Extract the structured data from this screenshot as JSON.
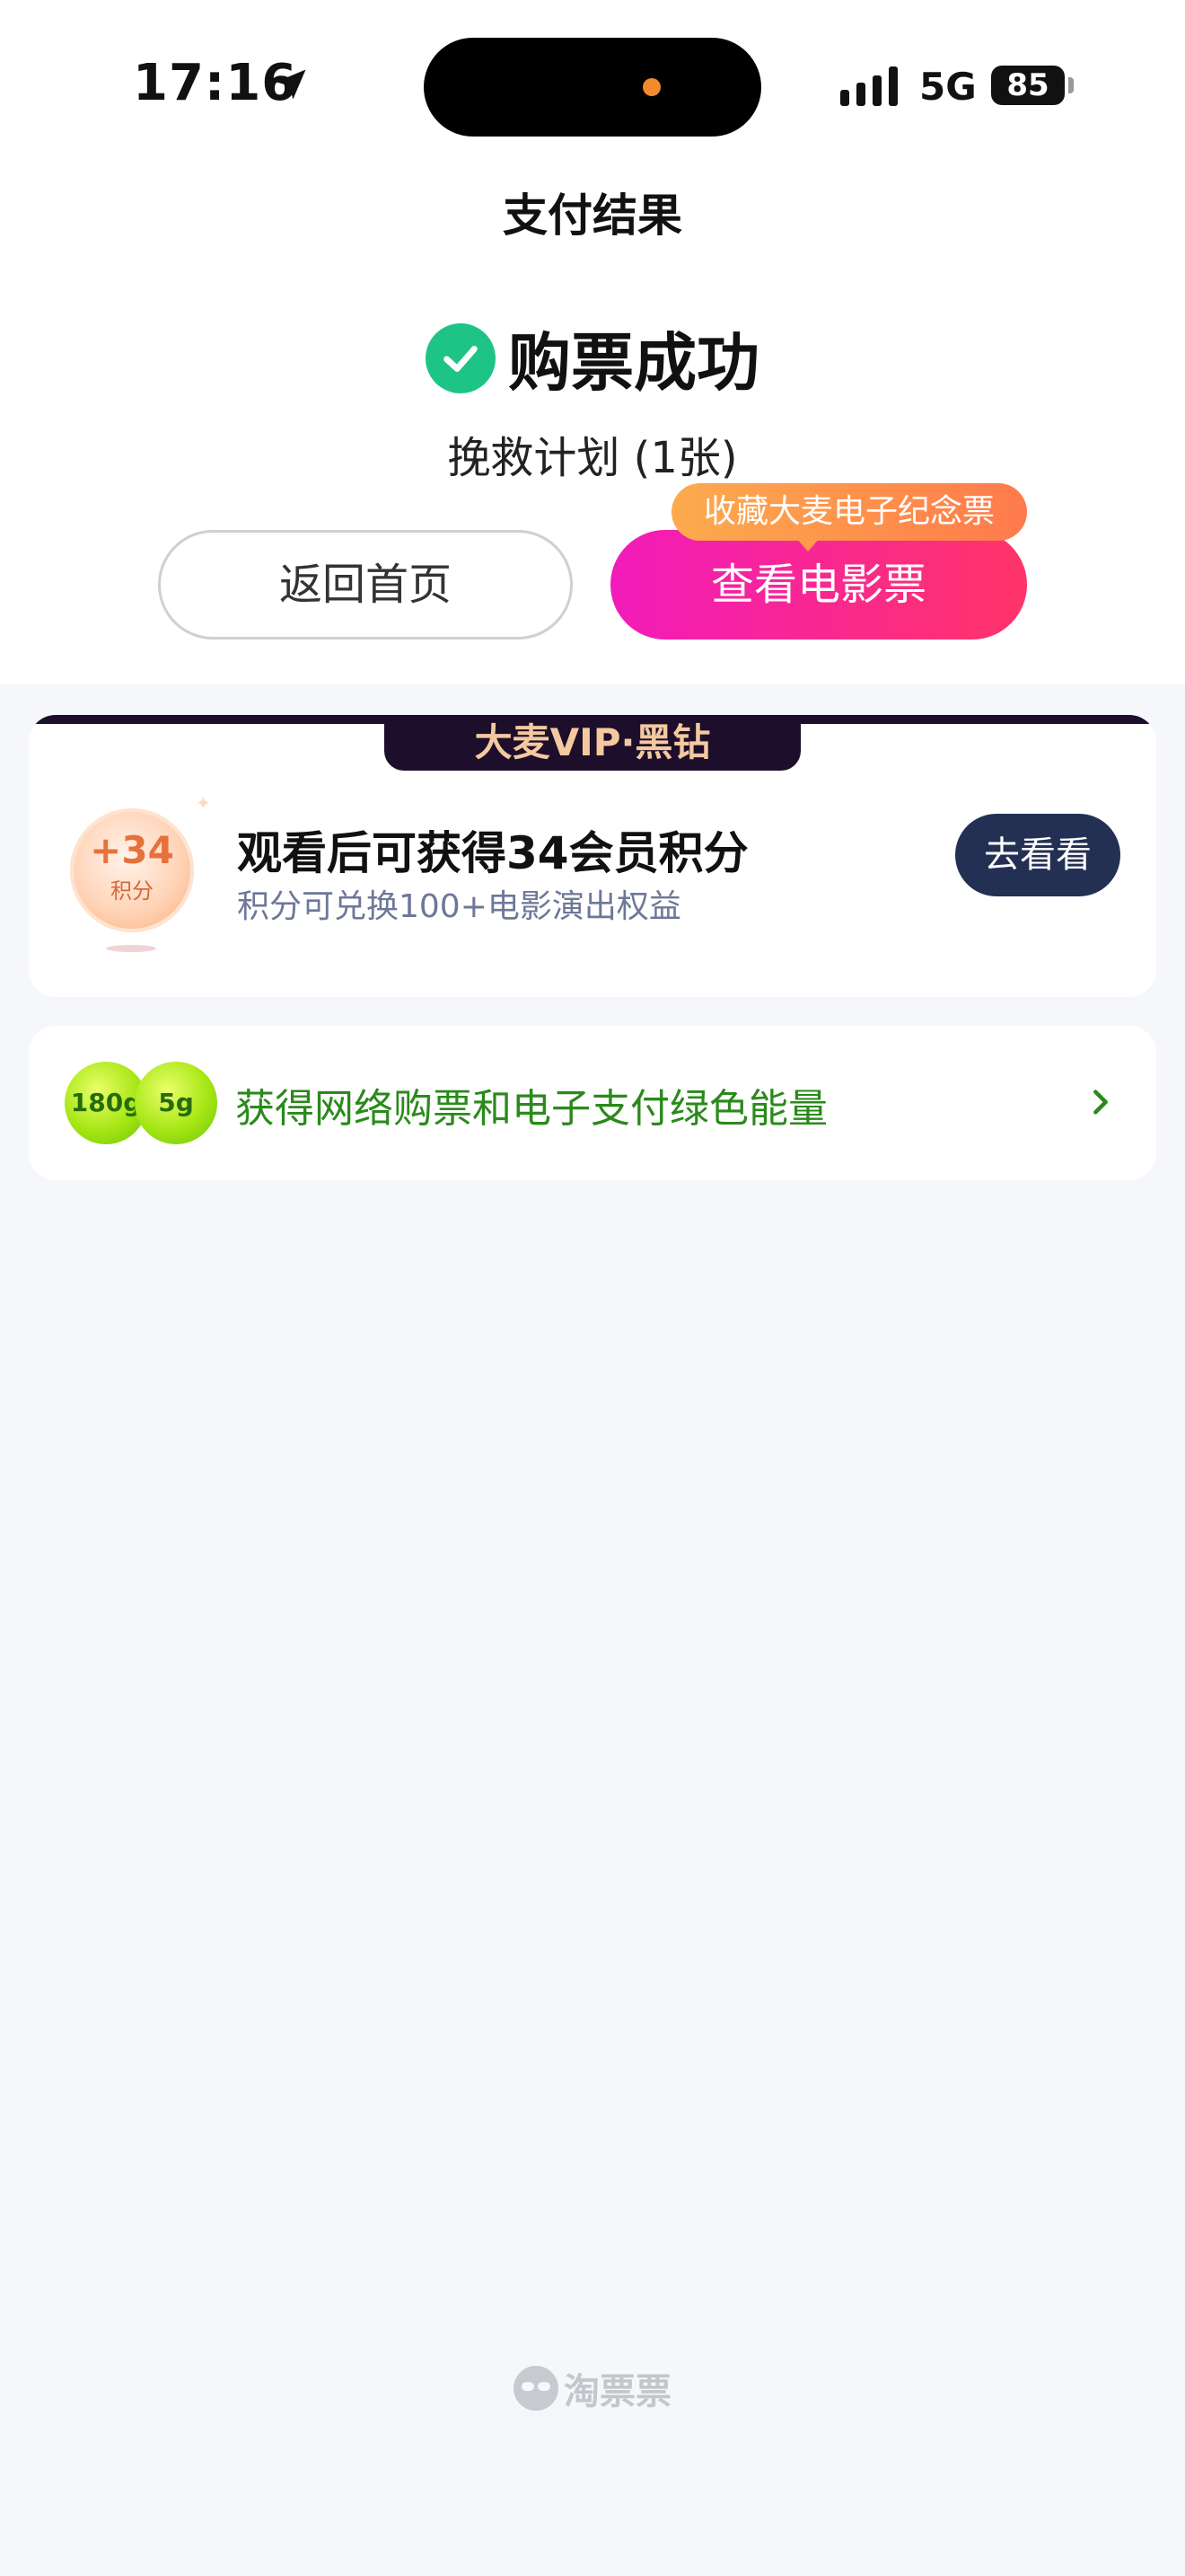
{
  "status_bar": {
    "time": "17:16",
    "network": "5G",
    "battery": "85"
  },
  "header": {
    "title": "支付结果"
  },
  "result": {
    "status": "购票成功",
    "movie": "挽救计划 (1张)"
  },
  "actions": {
    "home_label": "返回首页",
    "ticket_label": "查看电影票",
    "ticket_tip": "收藏大麦电子纪念票"
  },
  "vip_card": {
    "tag": "大麦VIP·黑钻",
    "coin_points": "+34",
    "coin_unit": "积分",
    "title": "观看后可获得34会员积分",
    "subtitle": "积分可兑换100+电影演出权益",
    "button_label": "去看看"
  },
  "green_card": {
    "badge1": "180g",
    "badge2": "5g",
    "text": "获得网络购票和电子支付绿色能量"
  },
  "footer": {
    "brand": "淘票票"
  },
  "colors": {
    "success": "#1ec485",
    "ticket_gradient_start": "#f21bbb",
    "ticket_gradient_end": "#ff3468",
    "vip_dark": "#1d0f2b",
    "green_text": "#2a8a1b"
  }
}
